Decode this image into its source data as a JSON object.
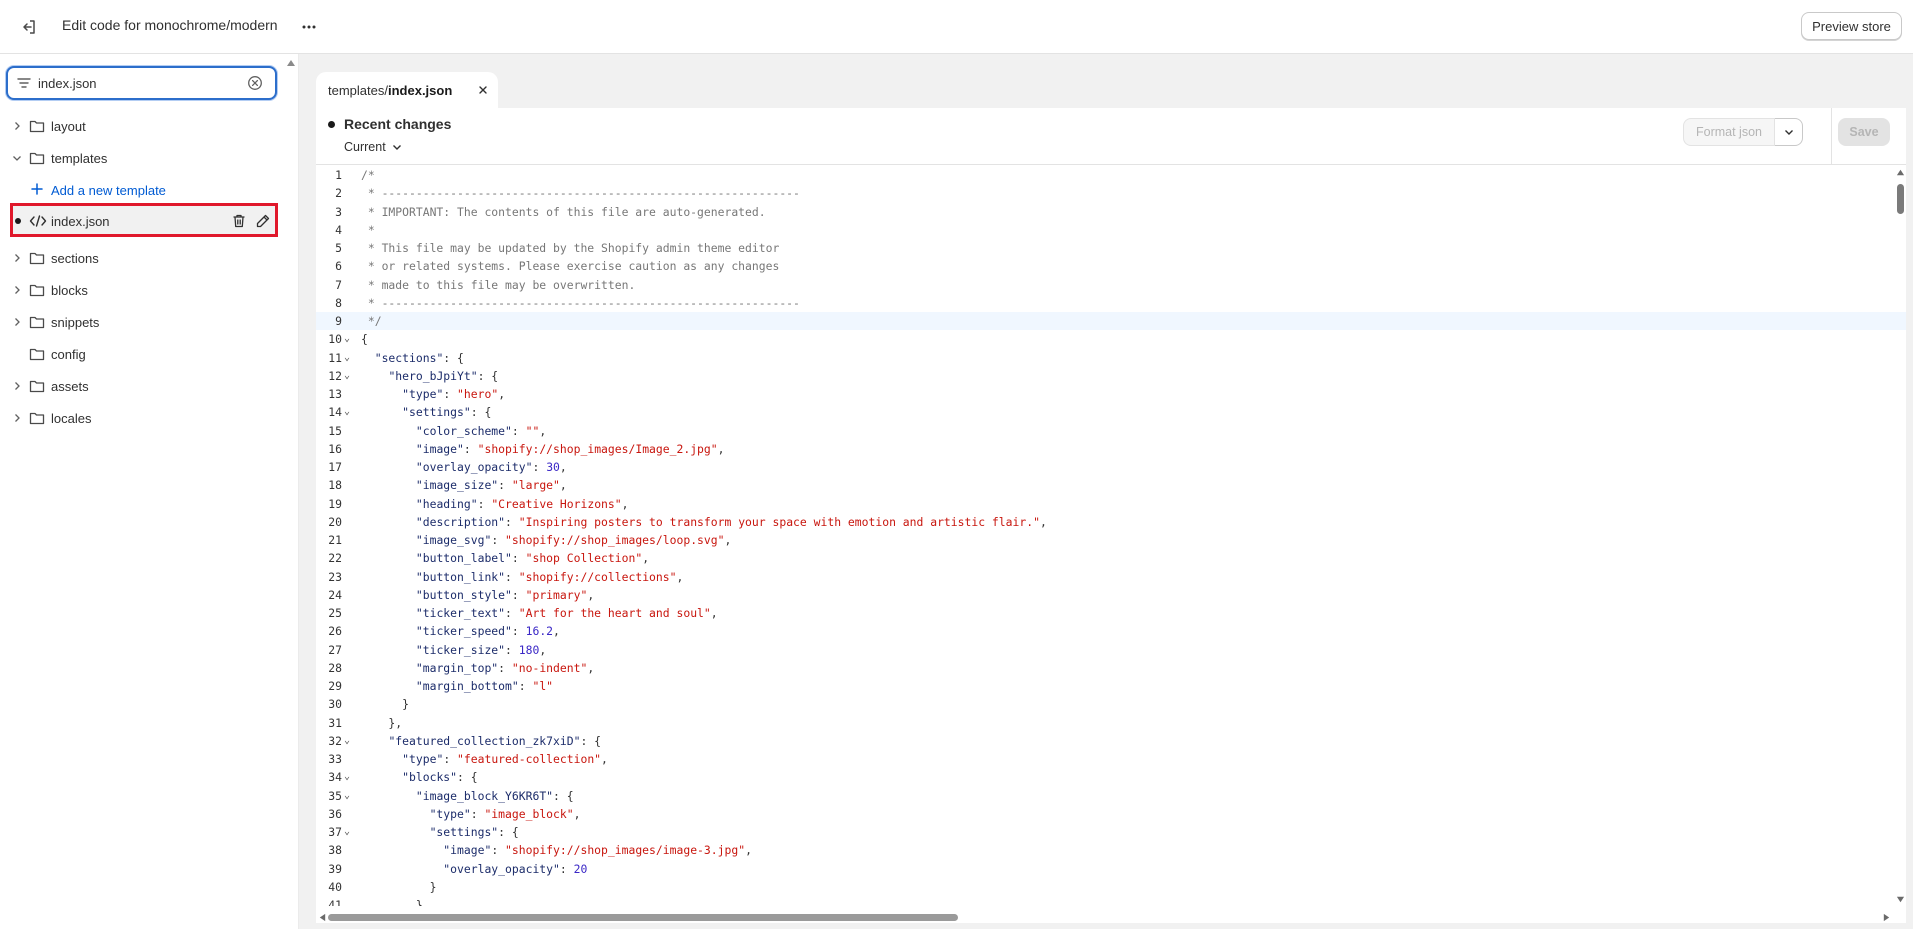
{
  "header": {
    "title": "Edit code for monochrome/modern",
    "preview_label": "Preview store"
  },
  "sidebar": {
    "search": {
      "value": "index.json",
      "placeholder": ""
    },
    "items": [
      {
        "label": "layout",
        "expanded": false
      },
      {
        "label": "templates",
        "expanded": true
      },
      {
        "label": "Add a new template"
      },
      {
        "label": "index.json"
      },
      {
        "label": "sections",
        "expanded": false
      },
      {
        "label": "blocks",
        "expanded": false
      },
      {
        "label": "snippets",
        "expanded": false
      },
      {
        "label": "config"
      },
      {
        "label": "assets",
        "expanded": false
      },
      {
        "label": "locales",
        "expanded": false
      }
    ]
  },
  "editor": {
    "tab": {
      "folder": "templates/",
      "file": "index.json"
    },
    "recent_changes": "Recent changes",
    "version": "Current",
    "format_label": "Format json",
    "save_label": "Save",
    "active_line": 9,
    "lines": [
      "/*",
      " * -------------------------------------------------------------",
      " * IMPORTANT: The contents of this file are auto-generated.",
      " *",
      " * This file may be updated by the Shopify admin theme editor",
      " * or related systems. Please exercise caution as any changes",
      " * made to this file may be overwritten.",
      " * -------------------------------------------------------------",
      " */",
      "{",
      "  \"sections\": {",
      "    \"hero_bJpiYt\": {",
      "      \"type\": \"hero\",",
      "      \"settings\": {",
      "        \"color_scheme\": \"\",",
      "        \"image\": \"shopify://shop_images/Image_2.jpg\",",
      "        \"overlay_opacity\": 30,",
      "        \"image_size\": \"large\",",
      "        \"heading\": \"Creative Horizons\",",
      "        \"description\": \"Inspiring posters to transform your space with emotion and artistic flair.\",",
      "        \"image_svg\": \"shopify://shop_images/loop.svg\",",
      "        \"button_label\": \"shop Collection\",",
      "        \"button_link\": \"shopify://collections\",",
      "        \"button_style\": \"primary\",",
      "        \"ticker_text\": \"Art for the heart and soul\",",
      "        \"ticker_speed\": 16.2,",
      "        \"ticker_size\": 180,",
      "        \"margin_top\": \"no-indent\",",
      "        \"margin_bottom\": \"l\"",
      "      }",
      "    },",
      "    \"featured_collection_zk7xiD\": {",
      "      \"type\": \"featured-collection\",",
      "      \"blocks\": {",
      "        \"image_block_Y6KR6T\": {",
      "          \"type\": \"image_block\",",
      "          \"settings\": {",
      "            \"image\": \"shopify://shop_images/image-3.jpg\",",
      "            \"overlay_opacity\": 20",
      "          }",
      "        },"
    ],
    "fold_lines": [
      10,
      11,
      12,
      14,
      32,
      34,
      35,
      37
    ]
  },
  "colors": {
    "accent": "#2c6ecb",
    "link": "#005bd3",
    "highlight_border": "#e0182b",
    "string": "#c8160e",
    "key": "#1c2c6a",
    "number": "#3a27c6"
  },
  "icons": {
    "exit": "exit-icon",
    "more": "more-horizontal-icon",
    "filter": "filter-icon",
    "clear": "clear-circle-icon",
    "folder": "folder-icon",
    "code": "code-icon",
    "trash": "trash-icon",
    "edit": "pencil-icon",
    "plus": "plus-icon",
    "chevron": "chevron-icon",
    "close": "close-icon"
  }
}
